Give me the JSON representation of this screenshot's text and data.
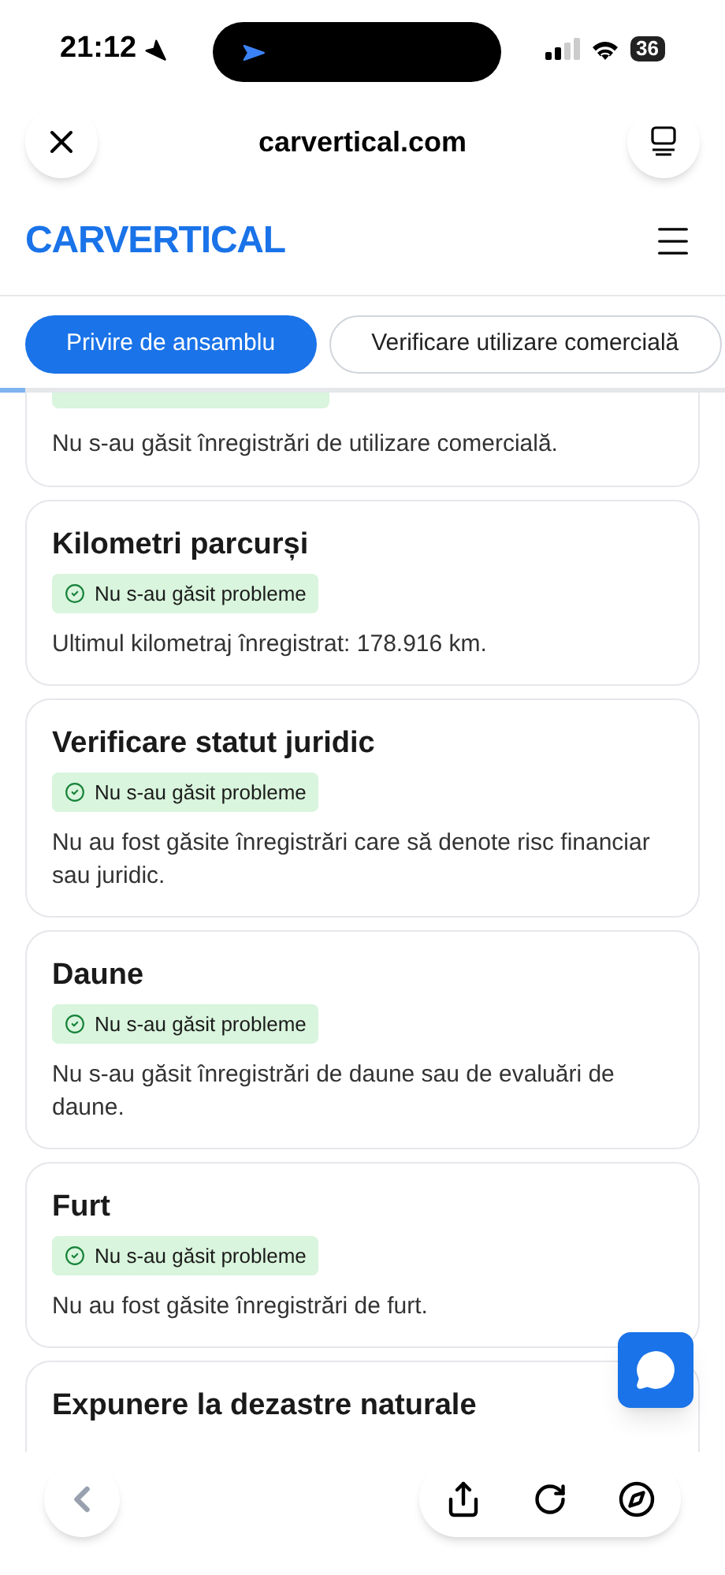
{
  "status_bar": {
    "time": "21:12",
    "battery": "36"
  },
  "browser": {
    "url": "carvertical.com"
  },
  "header": {
    "logo": "CARVERTICAL"
  },
  "tabs": [
    {
      "label": "Privire de ansamblu",
      "selected": true
    },
    {
      "label": "Verificare utilizare comercială",
      "selected": false
    }
  ],
  "cards": [
    {
      "kind": "cut",
      "description": "Nu s-au găsit înregistrări de utilizare comercială."
    },
    {
      "kind": "full",
      "title": "Kilometri parcurși",
      "status": "Nu s-au găsit probleme",
      "description": "Ultimul kilometraj înregistrat: 178.916 km."
    },
    {
      "kind": "full",
      "title": "Verificare statut juridic",
      "status": "Nu s-au găsit probleme",
      "description": "Nu au fost găsite înregistrări care să denote risc financiar sau juridic."
    },
    {
      "kind": "full",
      "title": "Daune",
      "status": "Nu s-au găsit probleme",
      "description": "Nu s-au găsit înregistrări de daune sau de evaluări de daune."
    },
    {
      "kind": "full",
      "title": "Furt",
      "status": "Nu s-au găsit probleme",
      "description": "Nu au fost găsite înregistrări de furt."
    },
    {
      "kind": "title_only",
      "title": "Expunere la dezastre naturale"
    }
  ]
}
